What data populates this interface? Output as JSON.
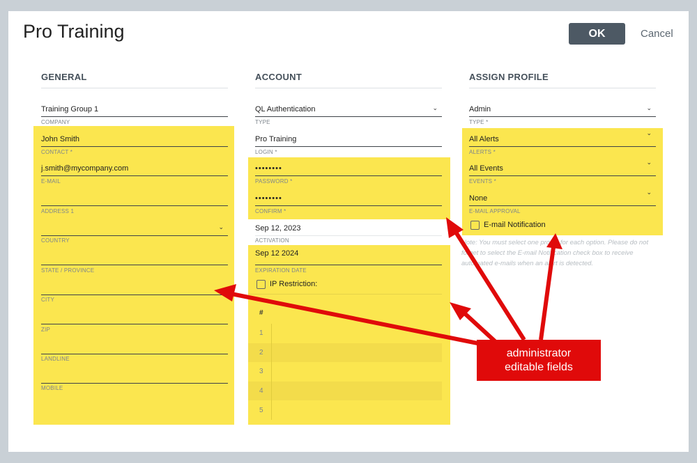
{
  "dialog": {
    "title": "Pro Training",
    "ok_label": "OK",
    "cancel_label": "Cancel"
  },
  "general": {
    "heading": "GENERAL",
    "fields": [
      {
        "value": "Training Group 1",
        "label": "COMPANY"
      },
      {
        "value": "John Smith",
        "label": "CONTACT *"
      },
      {
        "value": "j.smith@mycompany.com",
        "label": "E-MAIL"
      },
      {
        "value": "",
        "label": "ADDRESS 1"
      },
      {
        "value": "",
        "label": "COUNTRY"
      },
      {
        "value": "",
        "label": "STATE / PROVINCE"
      },
      {
        "value": "",
        "label": "CITY"
      },
      {
        "value": "",
        "label": "ZIP"
      },
      {
        "value": "",
        "label": "LANDLINE"
      },
      {
        "value": "",
        "label": "MOBILE"
      }
    ]
  },
  "account": {
    "heading": "ACCOUNT",
    "fields": [
      {
        "value": "QL Authentication",
        "label": "TYPE"
      },
      {
        "value": "Pro Training",
        "label": "LOGIN *"
      },
      {
        "value": "••••••••",
        "label": "PASSWORD *"
      },
      {
        "value": "••••••••",
        "label": "CONFIRM *"
      },
      {
        "value": "Sep 12, 2023",
        "label": "ACTIVATION"
      },
      {
        "value": "Sep 12 2024",
        "label": "EXPIRATION DATE"
      }
    ],
    "ip_restriction_label": "IP Restriction:",
    "ip_table": {
      "header": "#",
      "rows": [
        "1",
        "2",
        "3",
        "4",
        "5"
      ]
    }
  },
  "assign_profile": {
    "heading": "ASSIGN PROFILE",
    "fields": [
      {
        "value": "Admin",
        "label": "TYPE *"
      },
      {
        "value": "All Alerts",
        "label": "ALERTS *"
      },
      {
        "value": "All Events",
        "label": "EVENTS *"
      },
      {
        "value": "None",
        "label": "E-MAIL APPROVAL"
      }
    ],
    "email_notification_label": "E-mail Notification",
    "note": "Note: You must select one profile for each option. Please do not forget to select the E-mail Notification check box to receive automated e-mails when an alert is detected."
  },
  "annotation": {
    "line1": "administrator",
    "line2": "editable fields",
    "color": "#e00a0a",
    "highlight_color": "#fbe64f"
  }
}
